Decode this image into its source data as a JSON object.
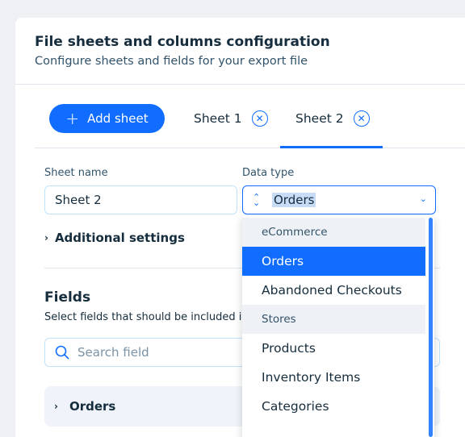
{
  "header": {
    "title": "File sheets and columns configuration",
    "subtitle": "Configure sheets and fields for your export file"
  },
  "toolbar": {
    "add_sheet_label": "Add sheet"
  },
  "tabs": [
    {
      "label": "Sheet 1",
      "active": false
    },
    {
      "label": "Sheet 2",
      "active": true
    }
  ],
  "form": {
    "sheet_name_label": "Sheet name",
    "sheet_name_value": "Sheet 2",
    "data_type_label": "Data type",
    "data_type_value": "Orders",
    "additional_settings_label": "Additional settings"
  },
  "dropdown": {
    "items": [
      {
        "label": "eCommerce",
        "type": "group"
      },
      {
        "label": "Orders",
        "type": "option",
        "selected": true
      },
      {
        "label": "Abandoned Checkouts",
        "type": "option"
      },
      {
        "label": "Stores",
        "type": "group"
      },
      {
        "label": "Products",
        "type": "option"
      },
      {
        "label": "Inventory Items",
        "type": "option"
      },
      {
        "label": "Categories",
        "type": "option"
      }
    ]
  },
  "fields": {
    "title": "Fields",
    "description": "Select fields that should be included i",
    "search_placeholder": "Search field",
    "group_label": "Orders"
  },
  "colors": {
    "accent": "#116dff",
    "text": "#162d3d",
    "muted": "#32536a"
  }
}
